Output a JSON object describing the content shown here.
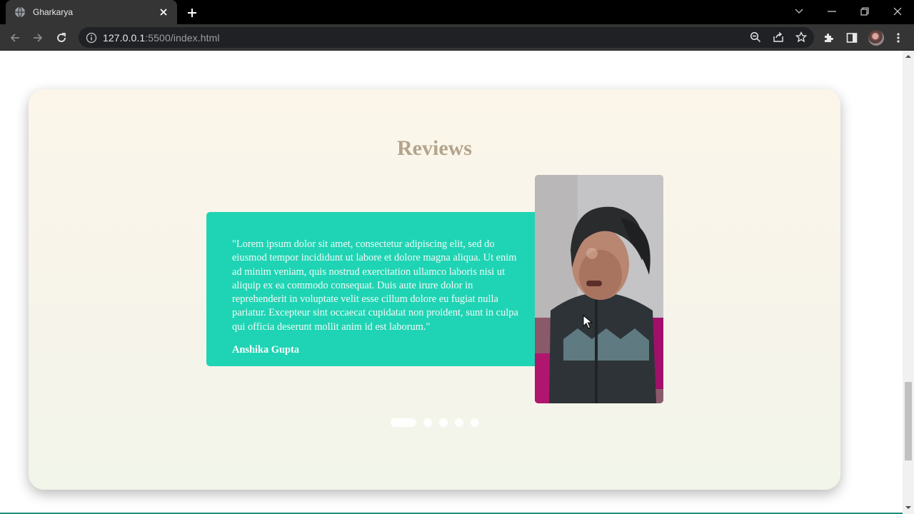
{
  "browser": {
    "tab": {
      "title": "Gharkarya",
      "favicon": "globe-icon",
      "close_icon": "close-icon"
    },
    "new_tab_icon": "plus-icon",
    "window_controls": [
      "chevron-down-icon",
      "minimize-icon",
      "restore-icon",
      "close-icon"
    ],
    "nav": [
      "back-icon",
      "forward-icon",
      "reload-icon"
    ],
    "address": {
      "host": "127.0.0.1",
      "rest": ":5500/index.html",
      "info_icon": "info-icon"
    },
    "omnibox_actions": [
      "zoom-icon",
      "share-icon",
      "star-icon"
    ],
    "toolbar_actions": [
      "extensions-icon",
      "side-panel-icon",
      "profile-avatar",
      "menu-icon"
    ]
  },
  "page": {
    "section_title": "Reviews",
    "review": {
      "text": "\"Lorem ipsum dolor sit amet, consectetur adipiscing elit, sed do eiusmod tempor incididunt ut labore et dolore magna aliqua. Ut enim ad minim veniam, quis nostrud exercitation ullamco laboris nisi ut aliquip ex ea commodo consequat. Duis aute irure dolor in reprehenderit in voluptate velit esse cillum dolore eu fugiat nulla pariatur. Excepteur sint occaecat cupidatat non proident, sunt in culpa qui officia deserunt mollit anim id est laborum.\"",
      "author": "Anshika Gupta"
    },
    "slider": {
      "total": 5,
      "active_index": 0
    }
  },
  "colors": {
    "accent": "#1fd4b4",
    "title": "#b3a48b",
    "chrome_bg": "#353535"
  }
}
